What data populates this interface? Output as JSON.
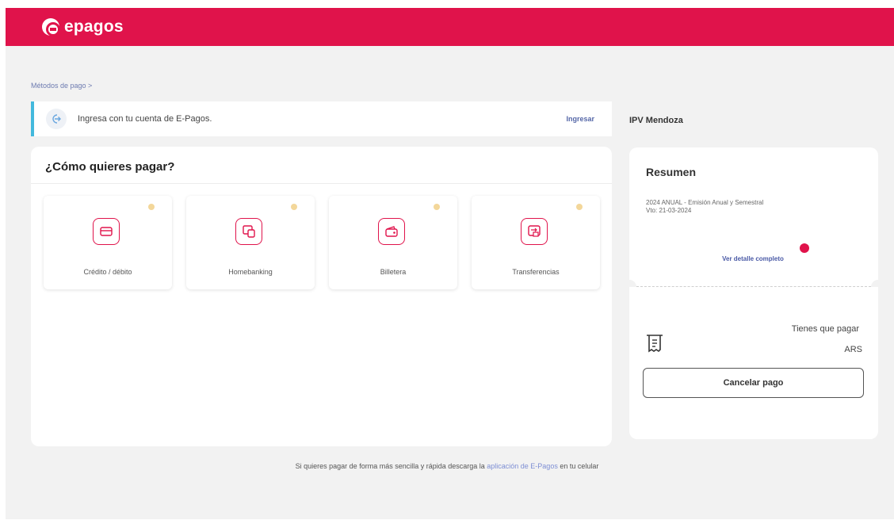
{
  "header": {
    "brand": "epagos",
    "brand_color": "#e0134b"
  },
  "breadcrumb": "Métodos de pago  >",
  "login_banner": {
    "icon": "login-arrow-icon",
    "text": "Ingresa con tu cuenta de E-Pagos.",
    "link": "Ingresar"
  },
  "payment": {
    "title": "¿Cómo quieres pagar?",
    "methods": [
      {
        "label": "Crédito / débito",
        "icon": "credit-card-icon"
      },
      {
        "label": "Homebanking",
        "icon": "homebanking-icon"
      },
      {
        "label": "Billetera",
        "icon": "wallet-icon"
      },
      {
        "label": "Transferencias",
        "icon": "transfer-icon"
      }
    ]
  },
  "sidebar": {
    "merchant": "IPV Mendoza",
    "summary": {
      "title": "Resumen",
      "line1": "2024 ANUAL - Emisión Anual y Semestral",
      "line2": "Vto: 21-03-2024",
      "detail_link": "Ver detalle completo"
    },
    "pay": {
      "label": "Tienes que pagar",
      "currency": "ARS",
      "cancel_button": "Cancelar pago",
      "icon": "receipt-icon"
    }
  },
  "footer": {
    "before": "Si quieres pagar de forma más sencilla y rápida descarga la ",
    "link": "aplicación de E-Pagos",
    "after": " en tu celular"
  }
}
